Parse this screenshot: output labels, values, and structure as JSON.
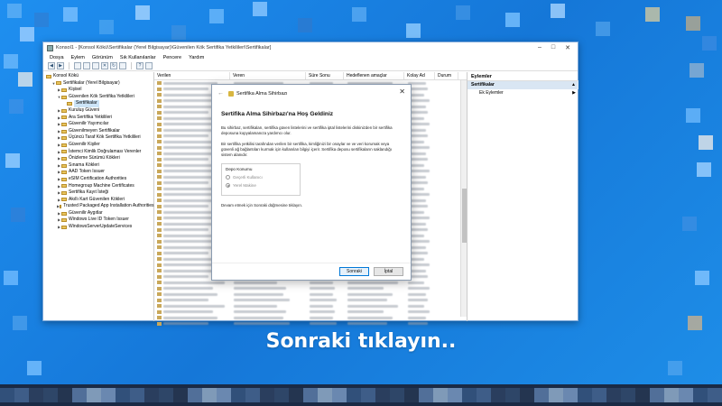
{
  "window": {
    "title": "Konsol1 - [Konsol Kökü\\Sertifikalar (Yerel Bilgisayar)\\Güvenilen Kök Sertifika Yetkilileri\\Sertifikalar]",
    "minimize": "–",
    "maximize": "□",
    "close": "✕"
  },
  "menu": [
    "Dosya",
    "Eylem",
    "Görünüm",
    "Sık Kullanılanlar",
    "Pencere",
    "Yardım"
  ],
  "tree": {
    "root": "Konsol Kökü",
    "items": [
      {
        "label": "Sertifikalar (Yerel Bilgisayar)",
        "level": 1,
        "expanded": true
      },
      {
        "label": "Kişisel",
        "level": 2,
        "expanded": false
      },
      {
        "label": "Güvenilen Kök Sertifika Yetkilileri",
        "level": 2,
        "expanded": true
      },
      {
        "label": "Sertifikalar",
        "level": 3,
        "selected": true
      },
      {
        "label": "Kuruluş Güveni",
        "level": 2,
        "expanded": false
      },
      {
        "label": "Ara Sertifika Yetkilileri",
        "level": 2,
        "expanded": false
      },
      {
        "label": "Güvenilir Yayımcılar",
        "level": 2,
        "expanded": false
      },
      {
        "label": "Güvenilmeyen Sertifikalar",
        "level": 2,
        "expanded": false
      },
      {
        "label": "Üçüncü Taraf Kök Sertifika Yetkilileri",
        "level": 2,
        "expanded": false
      },
      {
        "label": "Güvenilir Kişiler",
        "level": 2,
        "expanded": false
      },
      {
        "label": "İstemci Kimlik Doğrulaması Verenler",
        "level": 2,
        "expanded": false
      },
      {
        "label": "Önizleme Sürümü Kökleri",
        "level": 2,
        "expanded": false
      },
      {
        "label": "Sınama Kökleri",
        "level": 2,
        "expanded": false
      },
      {
        "label": "AAD Token Issuer",
        "level": 2,
        "expanded": false
      },
      {
        "label": "eSIM Certification Authorities",
        "level": 2,
        "expanded": false
      },
      {
        "label": "Homegroup Machine Certificates",
        "level": 2,
        "expanded": false
      },
      {
        "label": "Sertifika Kayıt İsteği",
        "level": 2,
        "expanded": false
      },
      {
        "label": "Akıllı Kart Güvenilen Kökleri",
        "level": 2,
        "expanded": false
      },
      {
        "label": "Trusted Packaged App Installation Authorities",
        "level": 2,
        "expanded": false
      },
      {
        "label": "Güvenilir Aygıtlar",
        "level": 2,
        "expanded": false
      },
      {
        "label": "Windows Live ID Token Issuer",
        "level": 2,
        "expanded": false
      },
      {
        "label": "WindowsServerUpdateServices",
        "level": 2,
        "expanded": false
      }
    ]
  },
  "list": {
    "columns": [
      "Verilen",
      "Veren",
      "Süre Sonu",
      "Hedeflenen amaçlar",
      "Kolay Ad",
      "Durum"
    ],
    "row_count": 42
  },
  "actions": {
    "header": "Eylemler",
    "section": "Sertifikalar",
    "item": "Ek Eylemler"
  },
  "wizard": {
    "title": "Sertifika Alma Sihirbazı",
    "back_icon": "←",
    "close": "✕",
    "heading": "Sertifika Alma Sihirbazı'na Hoş Geldiniz",
    "para1": "Bu sihirbaz, sertifikaları, sertifika güven listelerini ve sertifika iptal listelerini diskinizden bir sertifika deposuna kopyalamanıza yardımcı olur.",
    "para2": "Bir sertifika yetkilisi tarafından verilen bir sertifika, kimliğinizi bir onaylar ve ve veri korumak veya güvenli ağ bağlantıları kurmak için kullanılan bilgiyi içerir. Sertifika deposu sertifikaların saklandığı sistem alanıdır.",
    "store_label": "Depo Konumu",
    "options": [
      "Geçerli Kullanıcı",
      "Yerel Makine"
    ],
    "selected_option": 1,
    "continue_text": "Devam etmek için Sonraki düğmesine tıklayın.",
    "next_button": "Sonraki",
    "cancel_button": "İptal"
  },
  "caption": "Sonraki tıklayın.."
}
